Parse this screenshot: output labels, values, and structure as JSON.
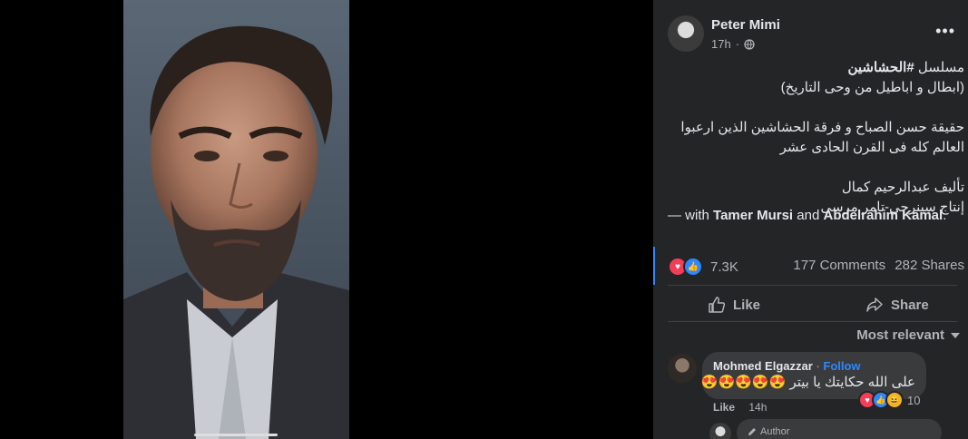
{
  "post": {
    "author": "Peter Mimi",
    "time": "17h",
    "text_line1_prefix": "مسلسل ",
    "text_line1_tag": "#الحشاشين",
    "text_line2": "(ابطال و اباطيل من وحى التاريخ)",
    "text_line3": "حقيقة حسن الصباح و فرقة الحشاشين الذين ارعبوا",
    "text_line4": "العالم كله فى القرن الحادى عشر",
    "text_line5": "تأليف عبدالرحيم كمال",
    "text_line6": "إنتاج سينرجي-تامر مرسى",
    "with_prefix": "— with ",
    "with_person1": "Tamer Mursi",
    "with_and": " and ",
    "with_person2": "Abdelrahim Kamal",
    "with_suffix": "."
  },
  "stats": {
    "reactions": "7.3K",
    "comments": "177 Comments",
    "shares": "282 Shares"
  },
  "actions": {
    "like": "Like",
    "share": "Share"
  },
  "comments_sort": "Most relevant",
  "comment": {
    "author": "Mohmed Elgazzar",
    "separator": "·",
    "follow": "Follow",
    "text": "على الله حكايتك يا بيتر 😍😍😍😍😍",
    "reaction_count": "10",
    "like": "Like",
    "time": "14h"
  },
  "reply": {
    "tag": "Author"
  },
  "icons": [
    "globe-icon",
    "more-icon",
    "love-reaction-icon",
    "like-reaction-icon",
    "haha-reaction-icon",
    "like-icon",
    "share-icon",
    "chevron-down-icon",
    "pencil-icon"
  ]
}
